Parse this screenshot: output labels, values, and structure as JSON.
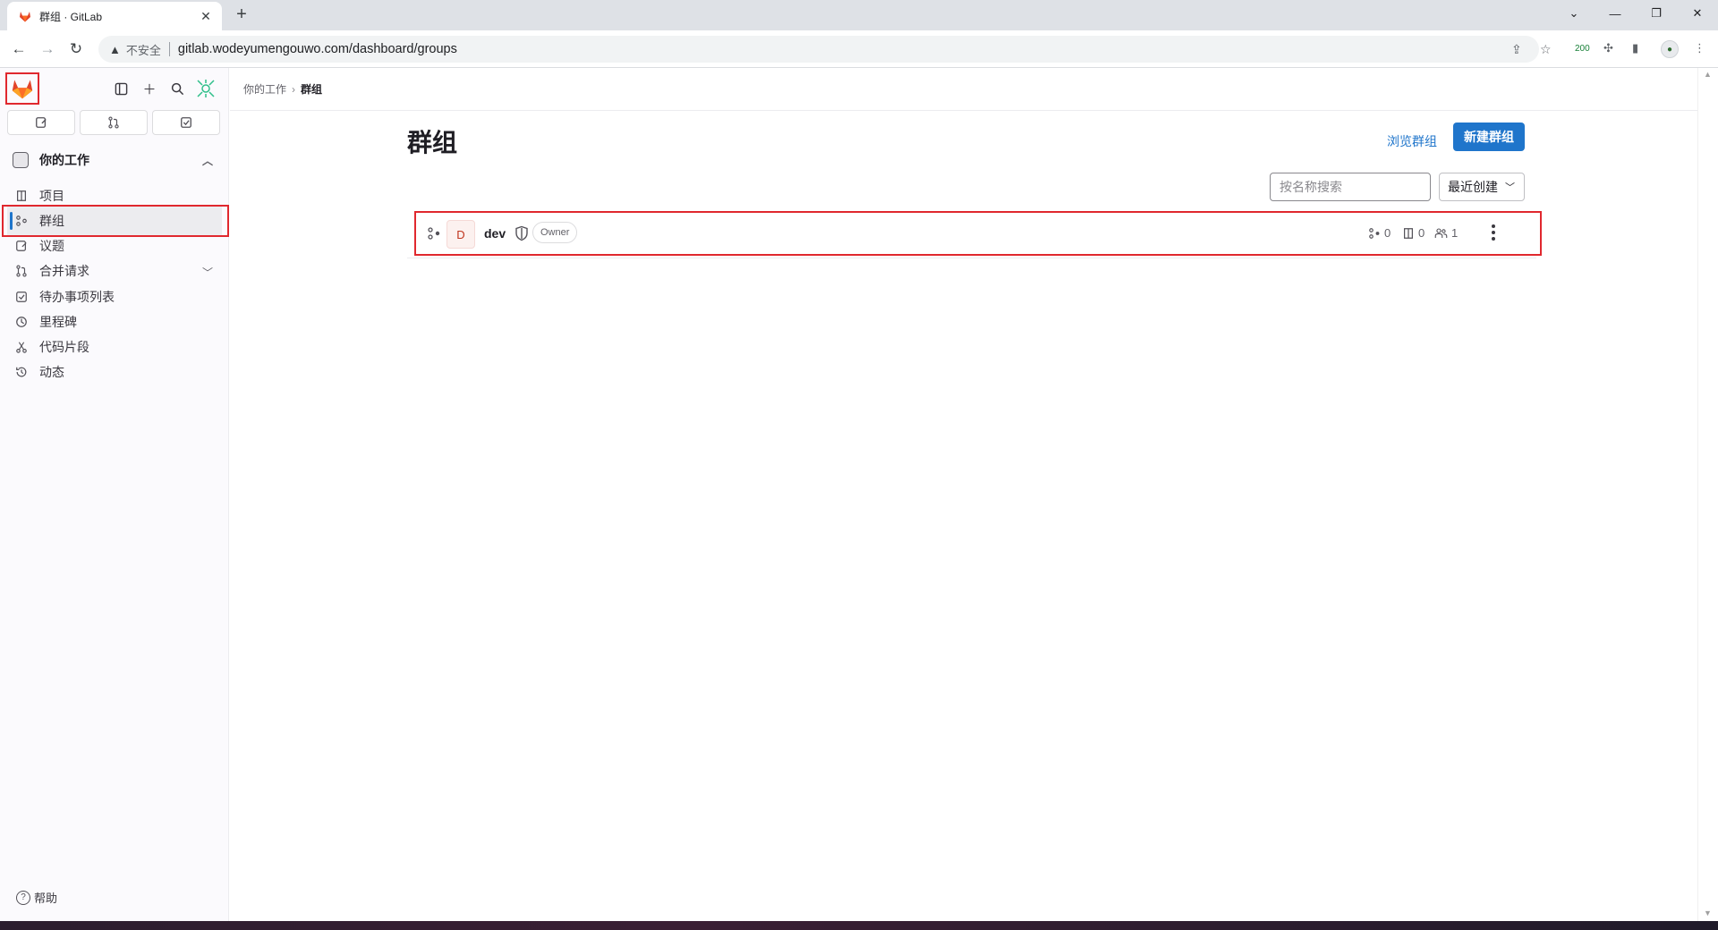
{
  "browser": {
    "tab_title": "群组 · GitLab",
    "insecure_label": "不安全",
    "url": "gitlab.wodeyumengouwo.com/dashboard/groups",
    "extension_badge": "200"
  },
  "sidebar": {
    "section_title": "你的工作",
    "items": [
      {
        "label": "项目",
        "icon": "project-icon"
      },
      {
        "label": "群组",
        "icon": "group-icon"
      },
      {
        "label": "议题",
        "icon": "issues-icon"
      },
      {
        "label": "合并请求",
        "icon": "merge-request-icon"
      },
      {
        "label": "待办事项列表",
        "icon": "todo-icon"
      },
      {
        "label": "里程碑",
        "icon": "milestone-icon"
      },
      {
        "label": "代码片段",
        "icon": "snippet-icon"
      },
      {
        "label": "动态",
        "icon": "activity-icon"
      }
    ],
    "help_label": "帮助"
  },
  "breadcrumb": {
    "parent": "你的工作",
    "current": "群组"
  },
  "main": {
    "title": "群组",
    "explore_link": "浏览群组",
    "new_group_button": "新建群组",
    "search_placeholder": "按名称搜索",
    "sort_label": "最近创建"
  },
  "groups": [
    {
      "avatar_letter": "D",
      "name": "dev",
      "role": "Owner",
      "subgroups": "0",
      "projects": "0",
      "members": "1"
    }
  ],
  "colors": {
    "accent": "#1f75cb",
    "highlight_border": "#e0282e",
    "gitlab_orange": "#e24329"
  }
}
